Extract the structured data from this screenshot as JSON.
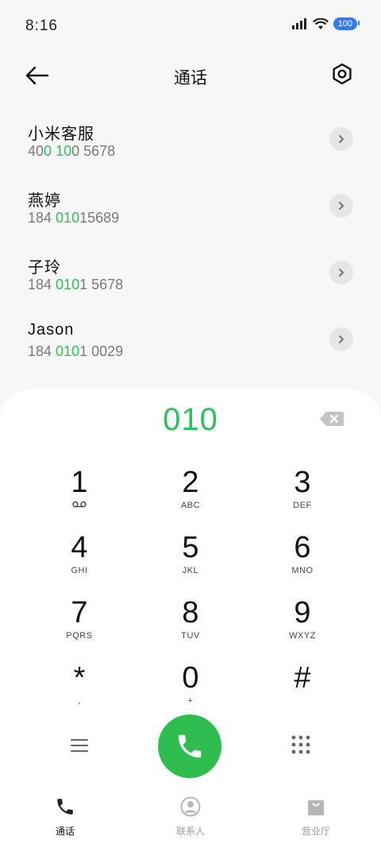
{
  "status_bar": {
    "time": "8:16",
    "battery": "100"
  },
  "header": {
    "title": "通话"
  },
  "contacts": [
    {
      "name": "小米客服",
      "number_parts": [
        "40",
        "0",
        " ",
        "10",
        "0 5678"
      ]
    },
    {
      "name": "燕婷",
      "number_parts": [
        "184 ",
        "010",
        "15689",
        "",
        ""
      ]
    },
    {
      "name": "子玲",
      "number_parts": [
        "184 ",
        "010",
        "1 5678",
        "",
        ""
      ]
    },
    {
      "name": "Jason",
      "number_parts": [
        "184 ",
        "010",
        "1 0029",
        "",
        ""
      ]
    }
  ],
  "dialpad": {
    "display": "010",
    "keys": [
      {
        "digit": "1",
        "letters": ""
      },
      {
        "digit": "2",
        "letters": "ABC"
      },
      {
        "digit": "3",
        "letters": "DEF"
      },
      {
        "digit": "4",
        "letters": "GHI"
      },
      {
        "digit": "5",
        "letters": "JKL"
      },
      {
        "digit": "6",
        "letters": "MNO"
      },
      {
        "digit": "7",
        "letters": "PQRS"
      },
      {
        "digit": "8",
        "letters": "TUV"
      },
      {
        "digit": "9",
        "letters": "WXYZ"
      },
      {
        "digit": "*",
        "letters": ","
      },
      {
        "digit": "0",
        "letters": "+"
      },
      {
        "digit": "#",
        "letters": ""
      }
    ]
  },
  "tabs": [
    {
      "label": "通话",
      "icon": "phone-icon",
      "active": true
    },
    {
      "label": "联系人",
      "icon": "person-icon",
      "active": false
    },
    {
      "label": "营业厅",
      "icon": "bag-icon",
      "active": false
    }
  ],
  "colors": {
    "accent": "#2fbf5b",
    "call_button": "#2ebd4e",
    "battery": "#3478f6"
  }
}
